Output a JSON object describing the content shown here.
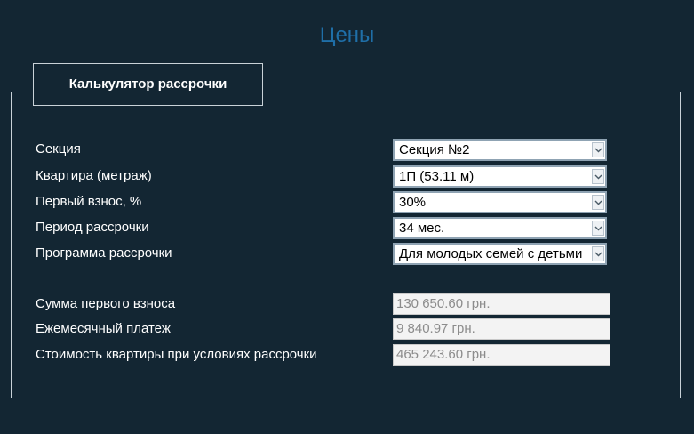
{
  "page": {
    "title": "Цены"
  },
  "calculator": {
    "tab_label": "Калькулятор рассрочки",
    "fields": [
      {
        "label": "Секция",
        "value": "Секция №2"
      },
      {
        "label": "Квартира (метраж)",
        "value": "1П (53.11 м)"
      },
      {
        "label": "Первый взнос, %",
        "value": "30%"
      },
      {
        "label": "Период рассрочки",
        "value": "34 мес."
      },
      {
        "label": "Программа рассрочки",
        "value": "Для молодых семей с детьми"
      }
    ],
    "results": [
      {
        "label": "Сумма первого взноса",
        "value": "130 650.60 грн."
      },
      {
        "label": "Ежемесячный платеж",
        "value": "9 840.97 грн."
      },
      {
        "label": "Стоимость квартиры при условиях рассрочки",
        "value": "465 243.60 грн."
      }
    ]
  },
  "colors": {
    "background": "#132633",
    "title": "#1f6fa8",
    "border": "#c9d2d8"
  }
}
